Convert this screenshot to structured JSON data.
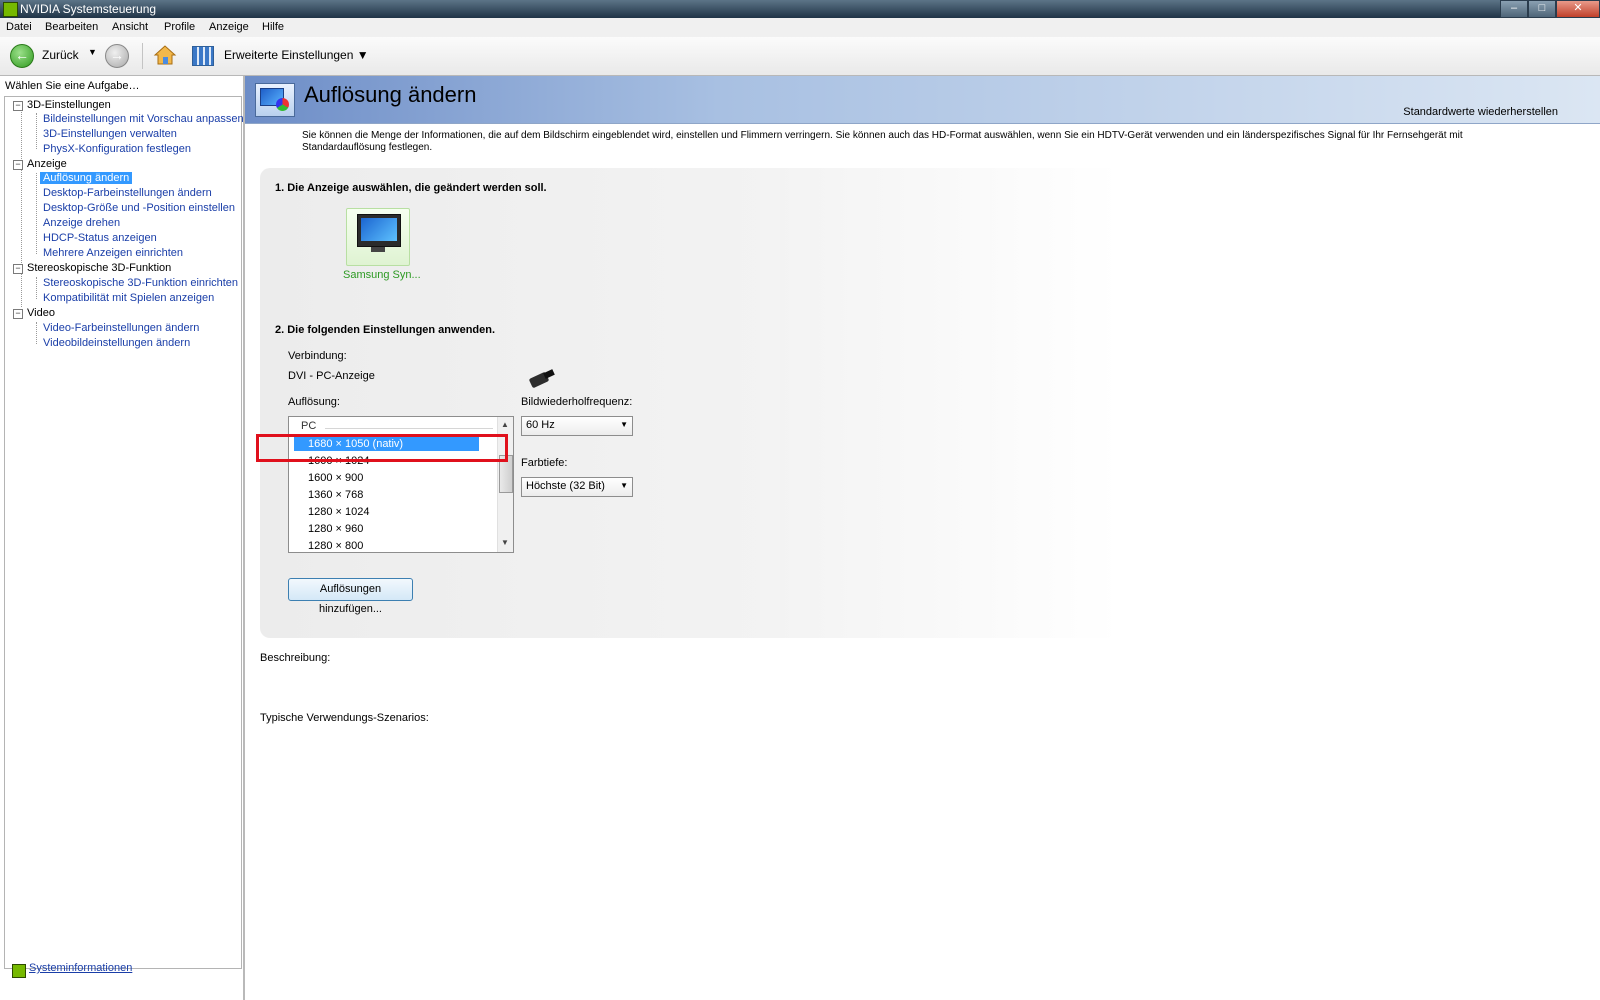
{
  "window": {
    "title": "NVIDIA Systemsteuerung",
    "controls": [
      "–",
      "□",
      "✕"
    ]
  },
  "menu": [
    "Datei",
    "Bearbeiten",
    "Ansicht",
    "Profile",
    "Anzeige",
    "Hilfe"
  ],
  "toolbar": {
    "back_label": "Zurück",
    "advanced_label": "Erweiterte Einstellungen"
  },
  "sidebar": {
    "heading": "Wählen Sie eine Aufgabe…",
    "categories": [
      {
        "label": "3D-Einstellungen",
        "items": [
          "Bildeinstellungen mit Vorschau anpassen",
          "3D-Einstellungen verwalten",
          "PhysX-Konfiguration festlegen"
        ]
      },
      {
        "label": "Anzeige",
        "items": [
          "Auflösung ändern",
          "Desktop-Farbeinstellungen ändern",
          "Desktop-Größe und -Position einstellen",
          "Anzeige drehen",
          "HDCP-Status anzeigen",
          "Mehrere Anzeigen einrichten"
        ]
      },
      {
        "label": "Stereoskopische 3D-Funktion",
        "items": [
          "Stereoskopische 3D-Funktion einrichten",
          "Kompatibilität mit Spielen anzeigen"
        ]
      },
      {
        "label": "Video",
        "items": [
          "Video-Farbeinstellungen ändern",
          "Videobildeinstellungen ändern"
        ]
      }
    ],
    "selected_item": "Auflösung ändern",
    "system_info": "Systeminformationen"
  },
  "page": {
    "title": "Auflösung ändern",
    "restore_defaults": "Standardwerte wiederherstellen",
    "intro": "Sie können die Menge der Informationen, die auf dem Bildschirm eingeblendet wird, einstellen und Flimmern verringern. Sie können auch das HD-Format auswählen, wenn Sie ein HDTV-Gerät verwenden und ein länderspezifisches Signal für Ihr Fernsehgerät mit Standardauflösung festlegen.",
    "step1": "1. Die Anzeige auswählen, die geändert werden soll.",
    "display_name": "Samsung Syn...",
    "step2": "2. Die folgenden Einstellungen anwenden.",
    "connection_label": "Verbindung:",
    "connection_value": "DVI - PC-Anzeige",
    "resolution_label": "Auflösung:",
    "resolution_group": "PC",
    "resolution_selected": "1680 × 1050 (nativ)",
    "resolutions": [
      "1600 × 1024",
      "1600 × 900",
      "1360 × 768",
      "1280 × 1024",
      "1280 × 960",
      "1280 × 800"
    ],
    "refresh_label": "Bildwiederholfrequenz:",
    "refresh_value": "60 Hz",
    "color_depth_label": "Farbtiefe:",
    "color_depth_value": "Höchste (32 Bit)",
    "add_resolutions_button": "Auflösungen hinzufügen...",
    "description_label": "Beschreibung:",
    "scenarios_label": "Typische Verwendungs-Szenarios:"
  }
}
